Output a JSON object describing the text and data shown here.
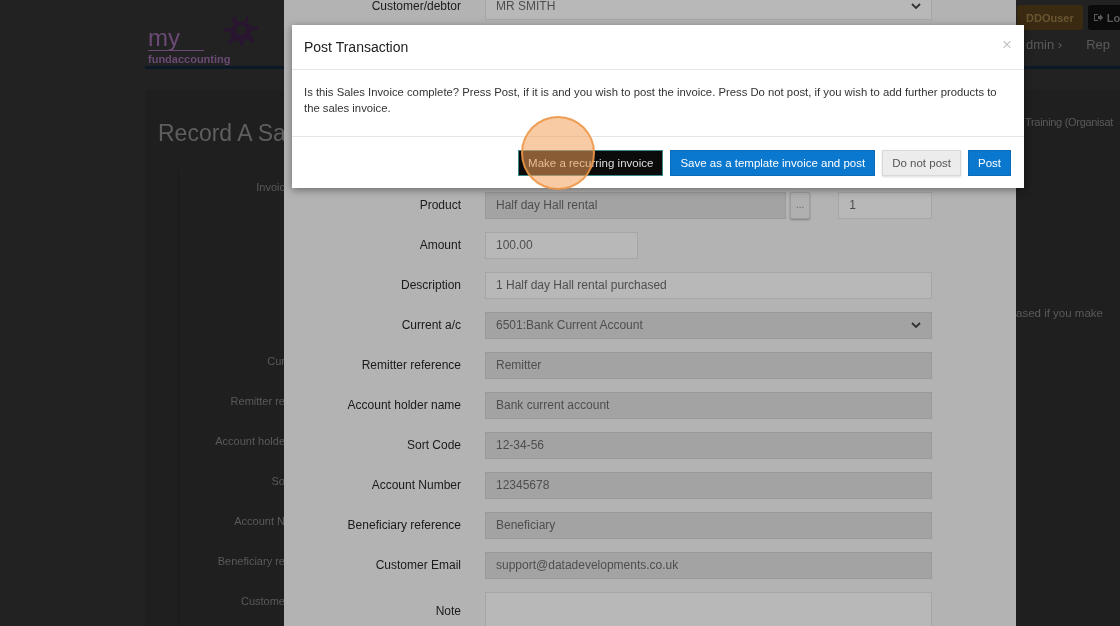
{
  "background_page": {
    "logo": {
      "top_word": "my",
      "bottom_word": "fundaccounting"
    },
    "user_button": "DDOuser",
    "logout_button": "Lo",
    "nav_items": [
      "dmin ›",
      "Rep"
    ],
    "heading": "Record A Sa",
    "organisation": "Training (Organisat",
    "form_labels": [
      "Invoic",
      "Cur",
      "Remitter re",
      "Account holde",
      "So",
      "Account N",
      "Beneficiary re",
      "Custome"
    ],
    "side_note": "ased if you make"
  },
  "form_panel": {
    "rows": [
      {
        "label": "Customer/debtor",
        "kind": "select",
        "value": "MR SMITH",
        "readonly": false
      },
      {
        "label": "Product",
        "kind": "product",
        "value": "Half day Hall rental",
        "readonly": true,
        "picker_button": "...",
        "quantity": "1"
      },
      {
        "label": "Amount",
        "kind": "short",
        "value": "100.00",
        "readonly": false
      },
      {
        "label": "Description",
        "kind": "input",
        "value": "1 Half day Hall rental purchased",
        "readonly": false
      },
      {
        "label": "Current a/c",
        "kind": "select",
        "value": "6501:Bank Current Account",
        "readonly": true
      },
      {
        "label": "Remitter reference",
        "kind": "input",
        "value": "Remitter",
        "readonly": true
      },
      {
        "label": "Account holder name",
        "kind": "input",
        "value": "Bank current account",
        "readonly": true
      },
      {
        "label": "Sort Code",
        "kind": "input",
        "value": "12-34-56",
        "readonly": true
      },
      {
        "label": "Account Number",
        "kind": "input",
        "value": "12345678",
        "readonly": true
      },
      {
        "label": "Beneficiary reference",
        "kind": "input",
        "value": "Beneficiary",
        "readonly": true
      },
      {
        "label": "Customer Email",
        "kind": "input",
        "value": "support@datadevelopments.co.uk",
        "readonly": true
      },
      {
        "label": "Note",
        "kind": "textarea",
        "readonly": false
      }
    ]
  },
  "dialog": {
    "title": "Post Transaction",
    "close": "×",
    "message": "Is this Sales Invoice complete? Press Post, if it is and you wish to post the invoice. Press Do not post, if you wish to add further products to the sales invoice.",
    "buttons": [
      {
        "label": "Make a recurring invoice",
        "kind": "dark"
      },
      {
        "label": "Save as a template invoice and post",
        "kind": "primary"
      },
      {
        "label": "Do not post",
        "kind": "default"
      },
      {
        "label": "Post",
        "kind": "primary"
      }
    ]
  }
}
